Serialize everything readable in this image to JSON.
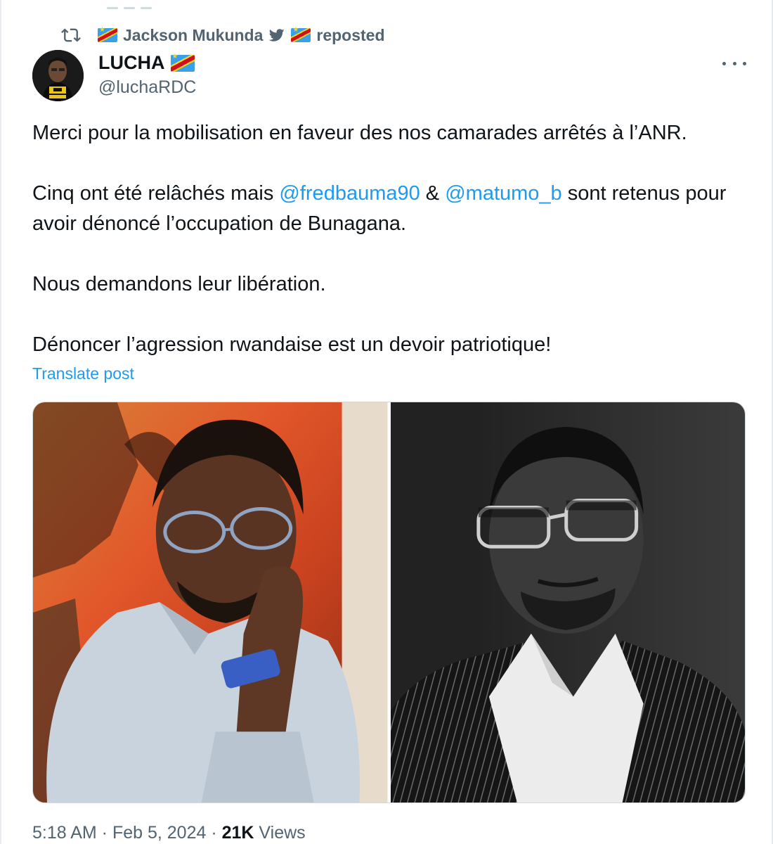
{
  "repost": {
    "reposter": "Jackson Mukunda",
    "suffix": "reposted",
    "icon": "repost-icon"
  },
  "author": {
    "display_name": "LUCHA",
    "handle": "@luchaRDC",
    "avatar_text": "LUCHA"
  },
  "post": {
    "line1": "Merci pour la mobilisation en faveur des nos camarades arrêtés à l’ANR.",
    "p2_start": "Cinq ont été relâchés mais ",
    "mention1": "@fredbauma90",
    "amp": " & ",
    "mention2": "@matumo_b",
    "p2_end": " sont retenus pour avoir dénoncé l’occupation de Bunagana.",
    "line3": "Nous demandons leur libération.",
    "line4": "Dénoncer l’agression rwandaise est un devoir patriotique!",
    "translate_label": "Translate post"
  },
  "media": [
    {
      "kind": "photo",
      "description_color": "color"
    },
    {
      "kind": "photo",
      "description_color": "grayscale"
    }
  ],
  "meta": {
    "time": "5:18 AM",
    "sep": " · ",
    "date": "Feb 5, 2024",
    "views_count": "21K",
    "views_label": " Views"
  },
  "colors": {
    "accent": "#1d9bf0",
    "secondary_text": "#536471",
    "primary_text": "#0f1419"
  }
}
